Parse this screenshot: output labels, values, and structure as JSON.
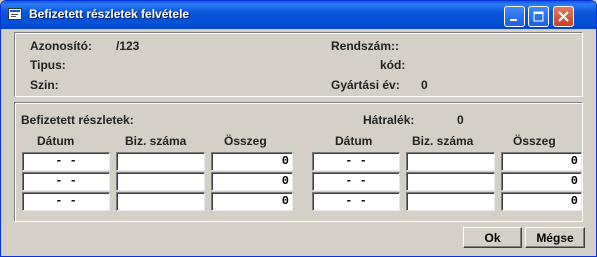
{
  "window": {
    "title": "Befizetett részletek felvétele"
  },
  "header": {
    "azonosito_label": "Azonosító:",
    "azonosito_value": "/123",
    "rendszam_label": "Rendszám::",
    "tipus_label": "Tipus:",
    "kod_label": "kód:",
    "szin_label": "Szin:",
    "gyartasi_ev_label": "Gyártási év:",
    "gyartasi_ev_value": "0"
  },
  "payments": {
    "section_label": "Befizetett részletek:",
    "hatralek_label": "Hátralék:",
    "hatralek_value": "0",
    "columns": {
      "datum": "Dátum",
      "biz_szama": "Biz. száma",
      "osszeg": "Összeg"
    },
    "left_rows": [
      {
        "date": "  -  -  ",
        "doc": "",
        "amount": "0"
      },
      {
        "date": "  -  -  ",
        "doc": "",
        "amount": "0"
      },
      {
        "date": "  -  -  ",
        "doc": "",
        "amount": "0"
      }
    ],
    "right_rows": [
      {
        "date": "  -  -  ",
        "doc": "",
        "amount": "0"
      },
      {
        "date": "  -  -  ",
        "doc": "",
        "amount": "0"
      },
      {
        "date": "  -  -  ",
        "doc": "",
        "amount": "0"
      }
    ]
  },
  "buttons": {
    "ok": "Ok",
    "cancel": "Mégse"
  },
  "icons": {
    "window_icon": "form-window-icon",
    "minimize": "minimize-icon",
    "maximize": "maximize-icon",
    "close": "close-icon"
  }
}
